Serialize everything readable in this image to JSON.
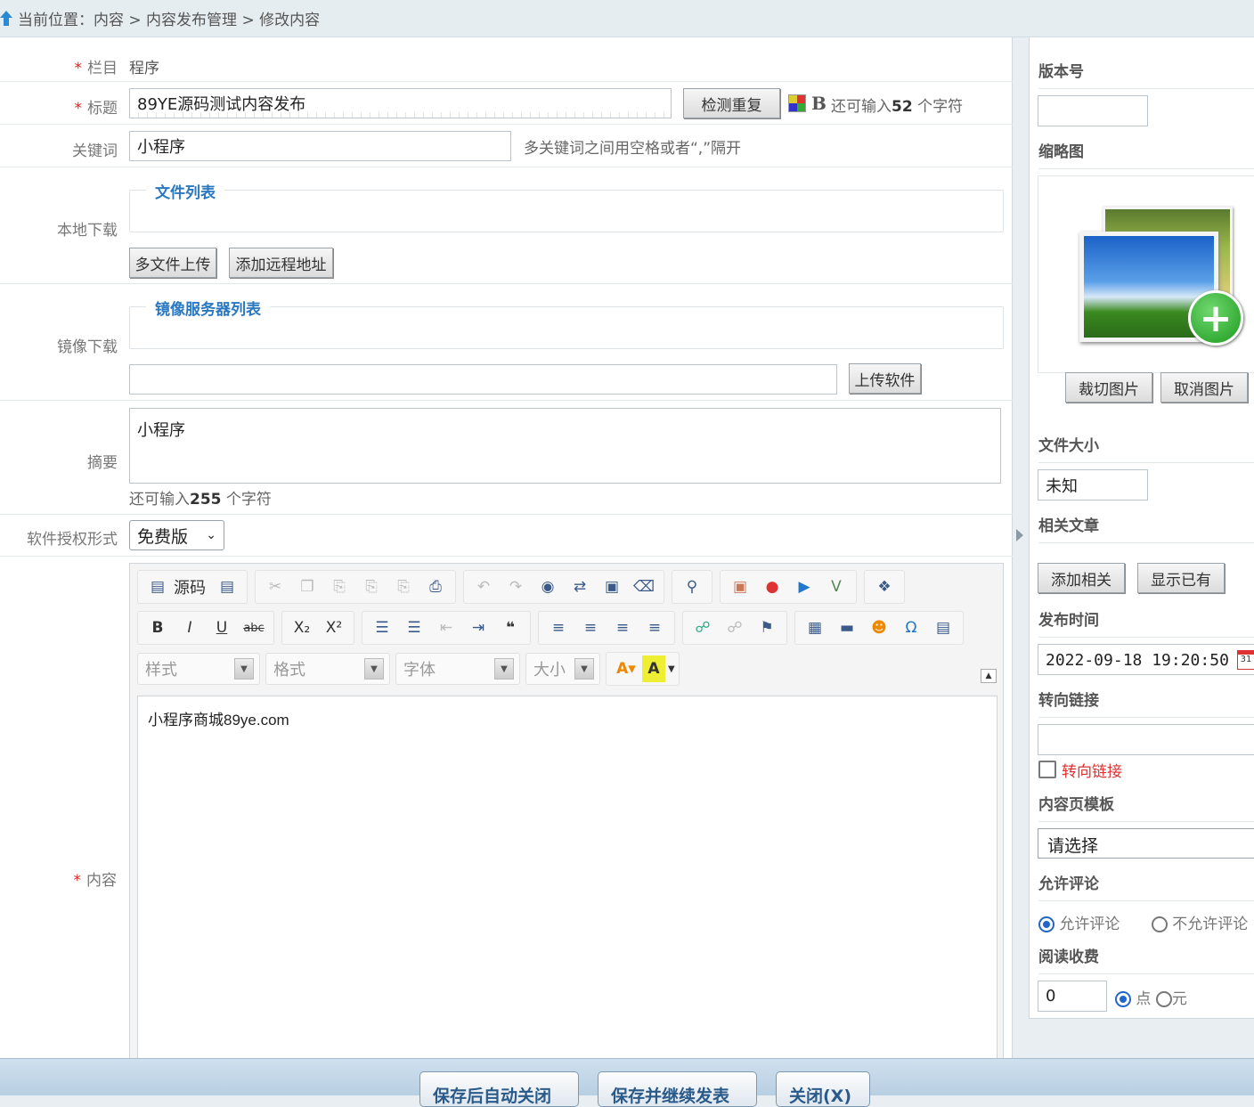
{
  "breadcrumb": "当前位置：内容 > 内容发布管理 > 修改内容",
  "form": {
    "category_label": "栏目",
    "category_value": "程序",
    "title_label": "标题",
    "title_value": "89YE源码测试内容发布",
    "check_dup_label": "检测重复",
    "title_remaining_prefix": "还可输入",
    "title_remaining_count": "52",
    "title_remaining_suffix": " 个字符",
    "keywords_label": "关键词",
    "keywords_value": "小程序",
    "keywords_hint": "多关键词之间用空格或者“,”隔开",
    "local_download_label": "本地下载",
    "file_list_legend": "文件列表",
    "multi_upload_label": "多文件上传",
    "add_remote_label": "添加远程地址",
    "mirror_download_label": "镜像下载",
    "mirror_list_legend": "镜像服务器列表",
    "upload_software_label": "上传软件",
    "summary_label": "摘要",
    "summary_value": "小程序",
    "summary_remaining_prefix": "还可输入",
    "summary_remaining_count": "255",
    "summary_remaining_suffix": " 个字符",
    "license_label": "软件授权形式",
    "license_value": "免费版",
    "content_label": "内容",
    "source_label": "源码",
    "style_placeholder": "样式",
    "format_placeholder": "格式",
    "font_placeholder": "字体",
    "size_placeholder": "大小",
    "content_value": "小程序商城89ye.com"
  },
  "sidebar": {
    "version_label": "版本号",
    "version_value": "",
    "thumb_label": "缩略图",
    "crop_label": "裁切图片",
    "cancel_img_label": "取消图片",
    "filesize_label": "文件大小",
    "filesize_value": "未知",
    "related_label": "相关文章",
    "add_related_label": "添加相关",
    "show_existing_label": "显示已有",
    "publish_time_label": "发布时间",
    "publish_time_value": "2022-09-18 19:20:50",
    "redirect_label": "转向链接",
    "redirect_value": "",
    "redirect_checkbox_label": "转向链接",
    "template_label": "内容页模板",
    "template_value": "请选择",
    "comment_label": "允许评论",
    "comment_allow": "允许评论",
    "comment_deny": "不允许评论",
    "fee_label": "阅读收费",
    "fee_value": "0",
    "fee_unit_points": "点",
    "fee_unit_yuan": "元"
  },
  "footer": {
    "save_close": "保存后自动关闭",
    "save_continue": "保存并继续发表",
    "close": "关闭(X)"
  },
  "colors": {
    "accent": "#2a78c2",
    "required": "#e02020"
  }
}
